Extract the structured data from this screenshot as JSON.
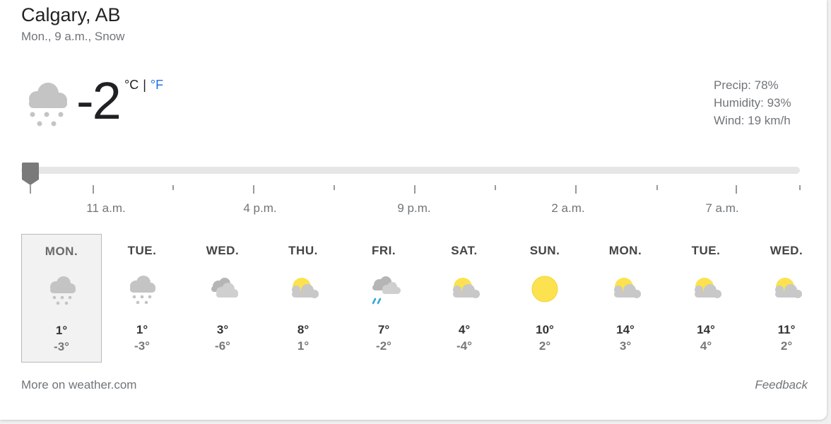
{
  "location": {
    "city": "Calgary, AB",
    "subtitle": "Mon., 9 a.m., Snow"
  },
  "current": {
    "icon": "snow-cloud-icon",
    "temperature": "-2",
    "unit_c": "°C",
    "unit_sep": "|",
    "unit_f": "°F",
    "precip": "Precip: 78%",
    "humidity": "Humidity: 93%",
    "wind": "Wind: 19 km/h"
  },
  "timeline": {
    "labels": [
      "11 a.m.",
      "4 p.m.",
      "9 p.m.",
      "2 a.m.",
      "7 a.m."
    ]
  },
  "forecast": [
    {
      "day": "MON.",
      "icon": "snow-icon",
      "high": "1°",
      "low": "-3°",
      "selected": true
    },
    {
      "day": "TUE.",
      "icon": "snow-icon",
      "high": "1°",
      "low": "-3°"
    },
    {
      "day": "WED.",
      "icon": "cloudy-icon",
      "high": "3°",
      "low": "-6°"
    },
    {
      "day": "THU.",
      "icon": "partly-cloudy-icon",
      "high": "8°",
      "low": "1°"
    },
    {
      "day": "FRI.",
      "icon": "showers-icon",
      "high": "7°",
      "low": "-2°"
    },
    {
      "day": "SAT.",
      "icon": "partly-cloudy-icon",
      "high": "4°",
      "low": "-4°"
    },
    {
      "day": "SUN.",
      "icon": "sunny-icon",
      "high": "10°",
      "low": "2°"
    },
    {
      "day": "MON.",
      "icon": "partly-cloudy-icon",
      "high": "14°",
      "low": "3°"
    },
    {
      "day": "TUE.",
      "icon": "partly-cloudy-icon",
      "high": "14°",
      "low": "4°"
    },
    {
      "day": "WED.",
      "icon": "partly-cloudy-icon",
      "high": "11°",
      "low": "2°"
    }
  ],
  "footer": {
    "more_link": "More on weather.com",
    "feedback": "Feedback"
  }
}
